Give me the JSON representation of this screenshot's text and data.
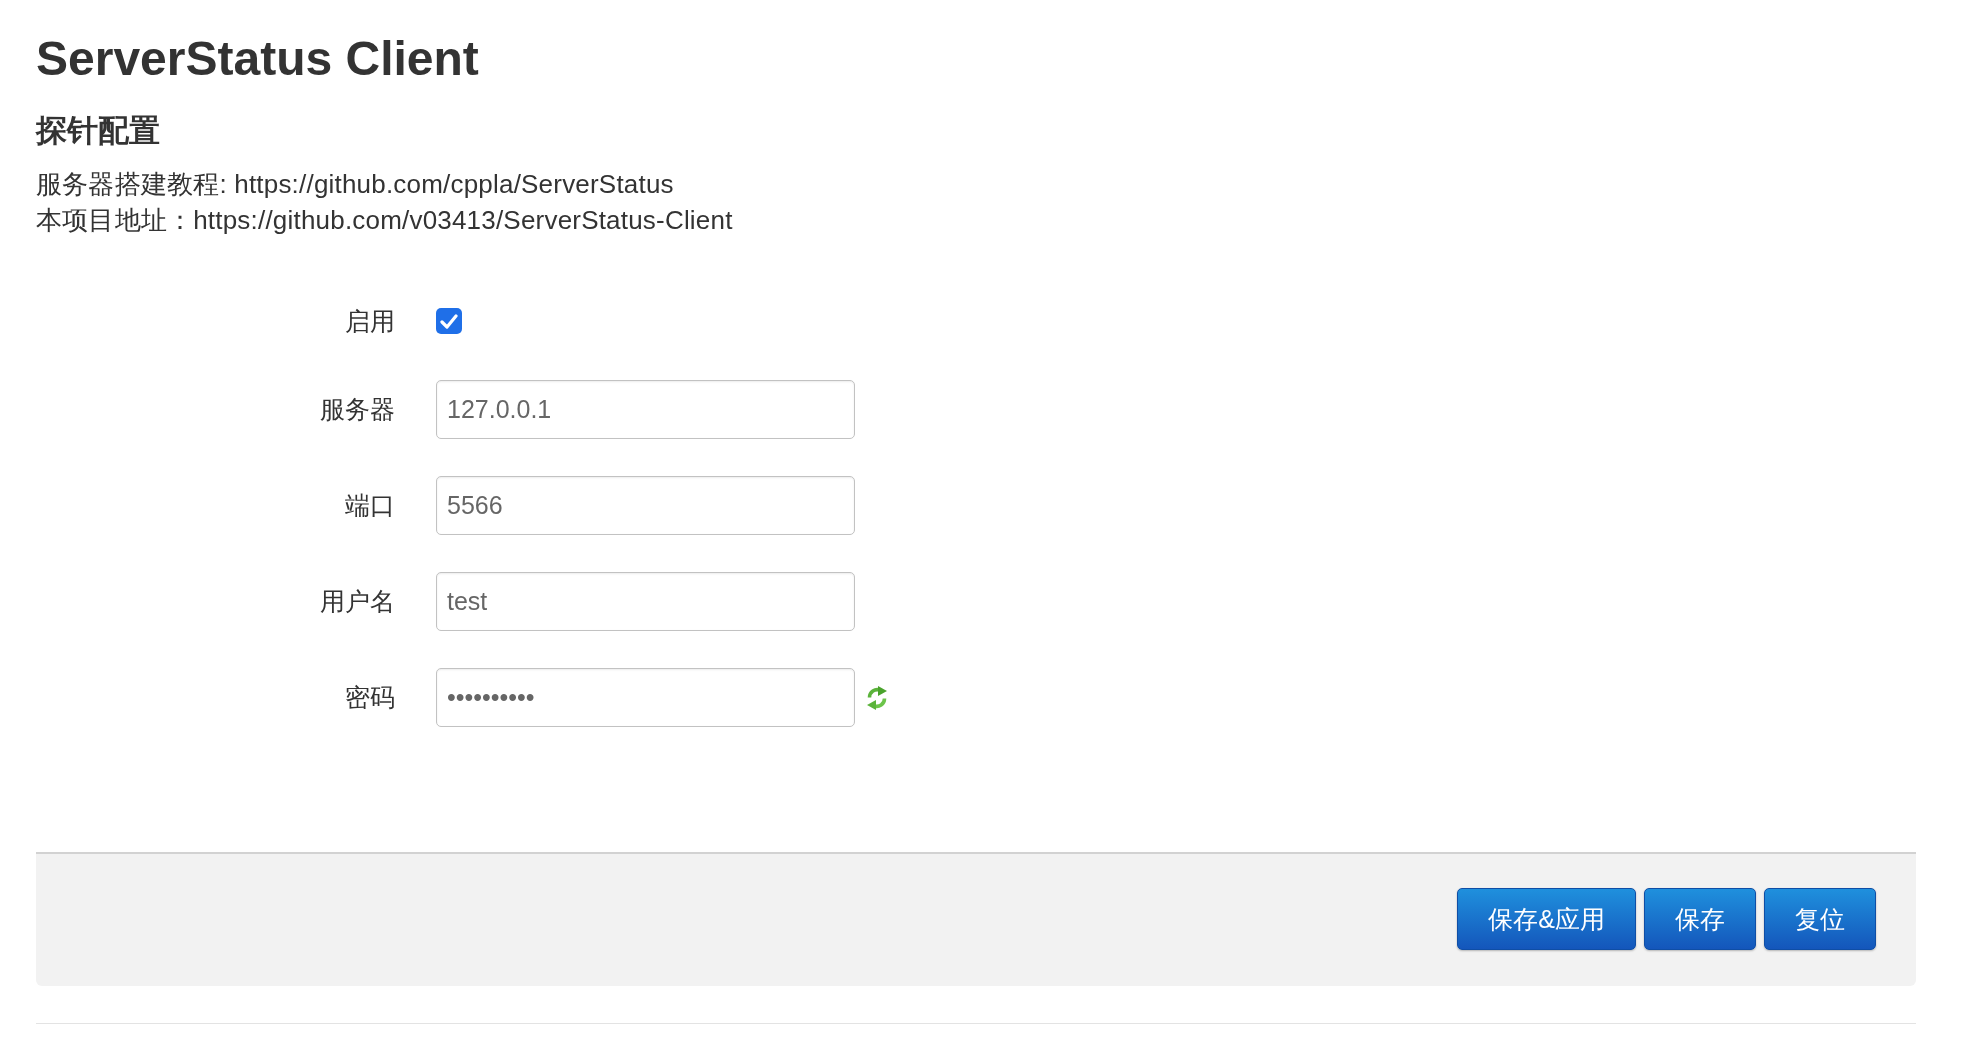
{
  "title": "ServerStatus Client",
  "section": {
    "title": "探针配置",
    "description": [
      "服务器搭建教程: https://github.com/cppla/ServerStatus",
      "本项目地址：https://github.com/v03413/ServerStatus-Client"
    ],
    "fields": [
      {
        "kind": "checkbox",
        "label": "启用",
        "checked": true
      },
      {
        "kind": "text",
        "label": "服务器",
        "value": "127.0.0.1"
      },
      {
        "kind": "text",
        "label": "端口",
        "value": "5566"
      },
      {
        "kind": "text",
        "label": "用户名",
        "value": "test"
      },
      {
        "kind": "password",
        "label": "密码",
        "value": "••••••••••"
      }
    ]
  },
  "buttons": [
    {
      "label": "保存&应用"
    },
    {
      "label": "保存"
    },
    {
      "label": "复位"
    }
  ]
}
